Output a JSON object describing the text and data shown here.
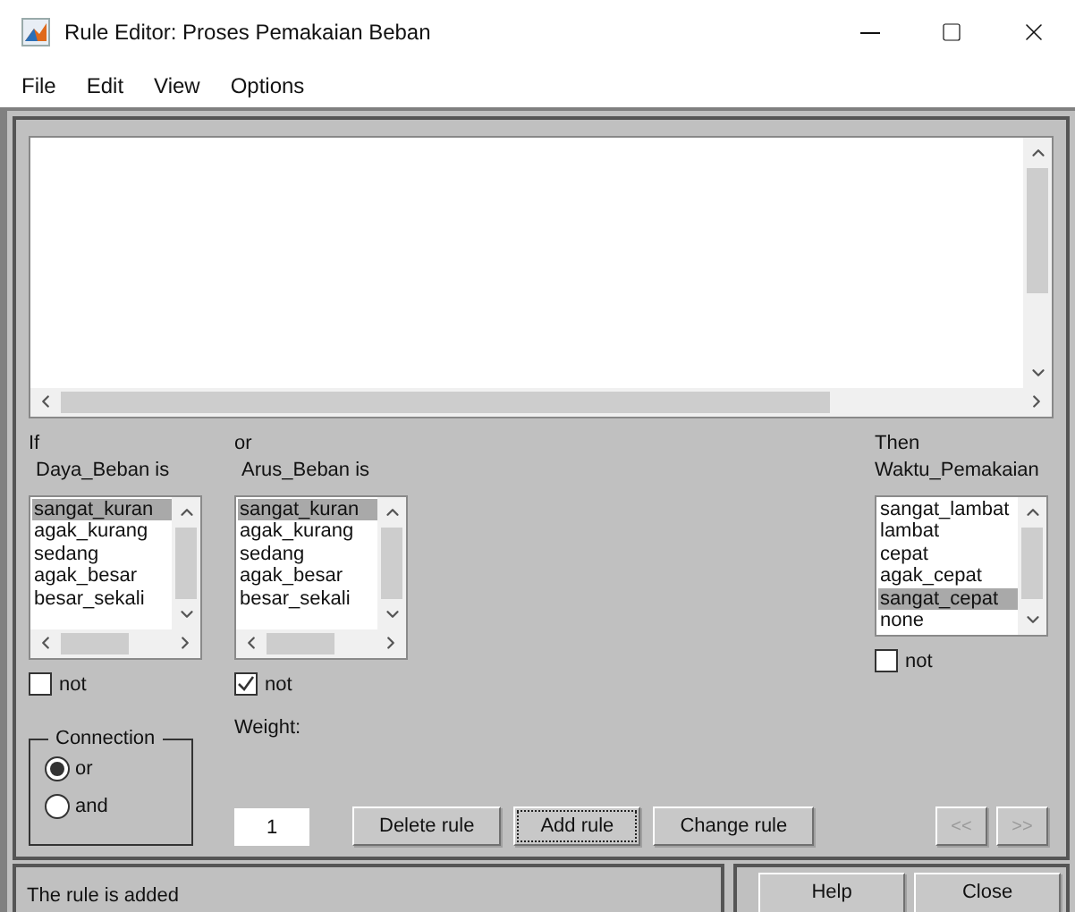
{
  "window": {
    "title": "Rule Editor: Proses Pemakaian Beban"
  },
  "menu": [
    "File",
    "Edit",
    "View",
    "Options"
  ],
  "inputs": [
    {
      "connector": "If",
      "variable": "Daya_Beban is",
      "items": [
        {
          "label": "sangat_kuran",
          "selected": true
        },
        {
          "label": "agak_kurang",
          "selected": false
        },
        {
          "label": "sedang",
          "selected": false
        },
        {
          "label": "agak_besar",
          "selected": false
        },
        {
          "label": "besar_sekali",
          "selected": false
        }
      ],
      "not": false,
      "not_label": "not"
    },
    {
      "connector": "or",
      "variable": "Arus_Beban is",
      "items": [
        {
          "label": "sangat_kuran",
          "selected": true
        },
        {
          "label": "agak_kurang",
          "selected": false
        },
        {
          "label": "sedang",
          "selected": false
        },
        {
          "label": "agak_besar",
          "selected": false
        },
        {
          "label": "besar_sekali",
          "selected": false
        }
      ],
      "not": true,
      "not_label": "not"
    }
  ],
  "output": {
    "connector": "Then",
    "variable": "Waktu_Pemakaian",
    "items": [
      {
        "label": "sangat_lambat",
        "selected": false
      },
      {
        "label": "lambat",
        "selected": false
      },
      {
        "label": "cepat",
        "selected": false
      },
      {
        "label": "agak_cepat",
        "selected": false
      },
      {
        "label": "sangat_cepat",
        "selected": true
      },
      {
        "label": "none",
        "selected": false
      }
    ],
    "not": false,
    "not_label": "not"
  },
  "connection": {
    "title": "Connection",
    "options": [
      {
        "label": "or",
        "selected": true
      },
      {
        "label": "and",
        "selected": false
      }
    ]
  },
  "weight": {
    "label": "Weight:",
    "value": "1"
  },
  "buttons": [
    {
      "label": "Delete rule",
      "focused": false
    },
    {
      "label": "Add rule",
      "focused": true
    },
    {
      "label": "Change rule",
      "focused": false
    }
  ],
  "nav_buttons": [
    {
      "label": "<<",
      "disabled": true
    },
    {
      "label": ">>",
      "disabled": true
    }
  ],
  "status": "The rule is added",
  "footer_buttons": [
    "Help",
    "Close"
  ]
}
